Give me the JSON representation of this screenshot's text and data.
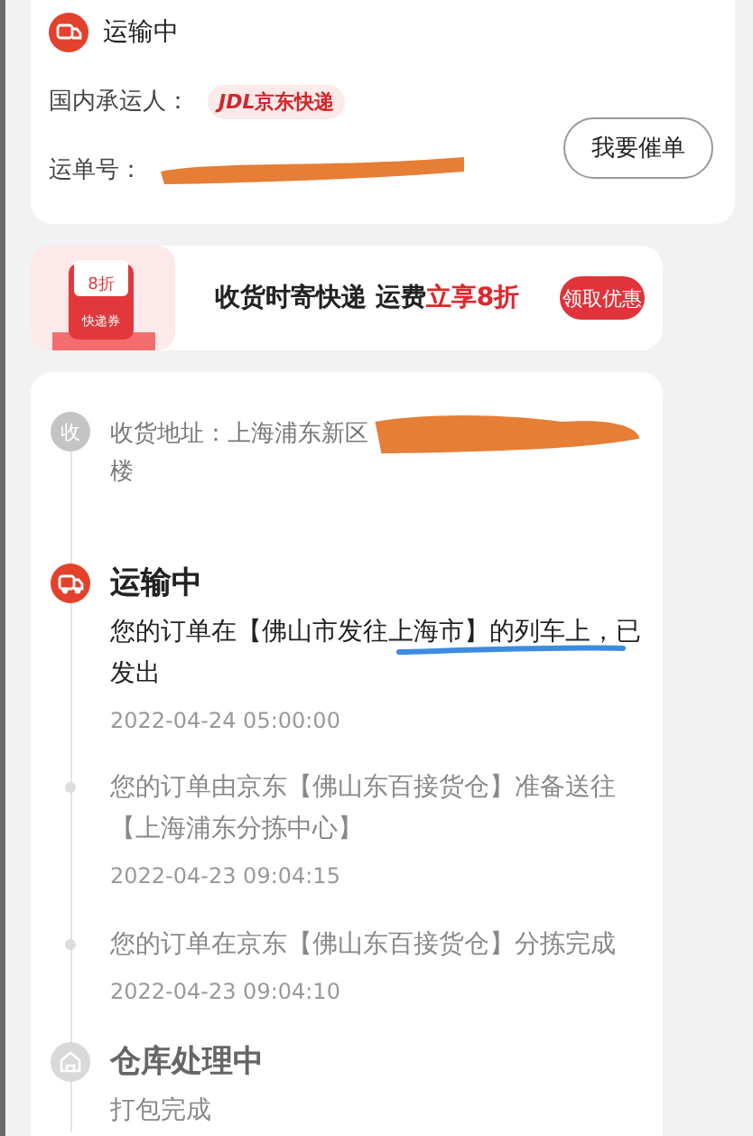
{
  "shipment": {
    "status": "运输中",
    "carrier_label": "国内承运人：",
    "carrier_badge_prefix": "JDL",
    "carrier_badge": "京东快递",
    "waybill_label": "运单号：",
    "waybill_redacted": true,
    "urge_button": "我要催单"
  },
  "promo": {
    "coupon_value": "8折",
    "coupon_label": "快递券",
    "text": "收货时寄快递 运费",
    "highlight": "立享8折",
    "button": "领取优惠"
  },
  "address": {
    "icon_text": "收",
    "line_1": "收货地址：上海浦东新区",
    "line_2": "楼",
    "redacted": true
  },
  "timeline": [
    {
      "kind": "stage",
      "title": "运输中",
      "active": true,
      "text": "您的订单在【佛山市发往上海市】的列车上，已发出",
      "underlined": true,
      "time": "2022-04-24 05:00:00"
    },
    {
      "kind": "event",
      "text": "您的订单由京东【佛山东百接货仓】准备送往【上海浦东分拣中心】",
      "underlined": false,
      "time": "2022-04-23 09:04:15"
    },
    {
      "kind": "event",
      "text": "您的订单在京东【佛山东百接货仓】分拣完成",
      "underlined": false,
      "time": "2022-04-23 09:04:10"
    },
    {
      "kind": "stage",
      "title": "仓库处理中",
      "active": false,
      "text": "打包完成",
      "underlined": false
    }
  ]
}
